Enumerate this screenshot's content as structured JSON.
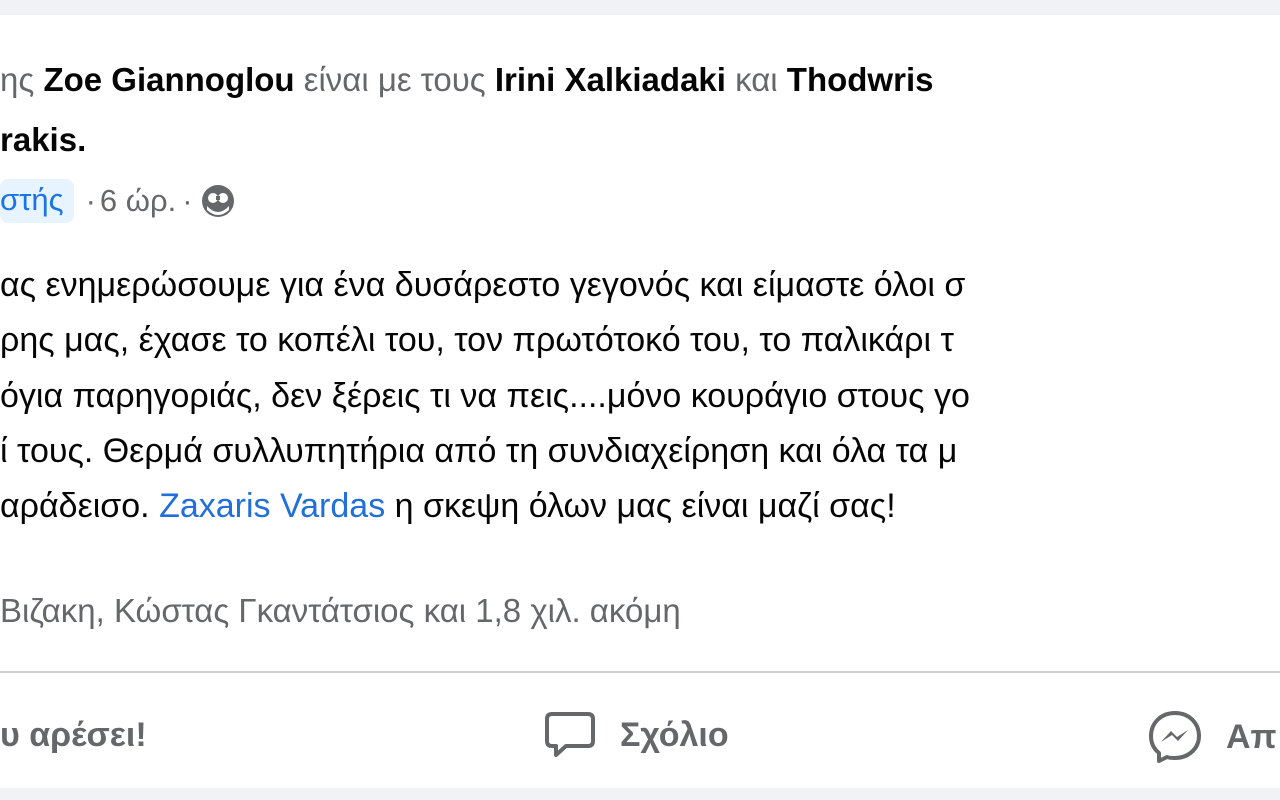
{
  "post": {
    "header": {
      "frag_prefix": "ης ",
      "author": "Zoe Giannoglou",
      "with_text": " είναι με τους ",
      "tag1": "Irini Xalkiadaki",
      "and_text": " και ",
      "tag2_part1": "Thodwris",
      "tag2_part2": "rakis",
      "period": "."
    },
    "meta": {
      "role_badge": "στής",
      "sep1": "·",
      "time": "6 ώρ.",
      "sep2": "·",
      "privacy_icon": "globe-icon"
    },
    "body": {
      "line1": "ας ενημερώσουμε για ένα δυσάρεστο γεγονός και είμαστε όλοι σ",
      "line2": "ρης μας, έχασε το κοπέλι του, τον πρωτότοκό του, το παλικάρι τ",
      "line3": "όγια παρηγοριάς, δεν ξέρεις τι να πεις....μόνο κουράγιο στους γο",
      "line4": "ί τους. Θερμά συλλυπητήρια από τη συνδιαχείρηση και όλα τα μ",
      "line5_pre": "αράδεισο. ",
      "line5_mention": "Zaxaris Vardas",
      "line5_post": " η σκεψη όλων μας είναι μαζί σας!"
    },
    "reactions": {
      "text": "Βιζακη, Κώστας Γκαντάτσιος και 1,8 χιλ. ακόμη"
    },
    "actions": {
      "like_label": "υ αρέσει!",
      "comment_label": "Σχόλιο",
      "comment_icon": "comment-icon",
      "send_label": "Απ",
      "send_icon": "messenger-icon"
    }
  }
}
